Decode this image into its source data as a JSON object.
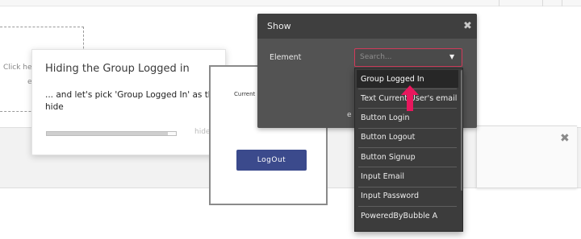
{
  "canvas": {
    "hint_line1": "Click he",
    "hint_line2": "e"
  },
  "tutorial": {
    "title": "Hiding the Group Logged in",
    "body": "... and let's pick 'Group Logged In' as the el to hide",
    "hide_label": "hide",
    "progress": 0.94
  },
  "preview": {
    "email_text": "Current User's email",
    "logout_label": "LogOut"
  },
  "show_panel": {
    "title": "Show",
    "element_label": "Element",
    "search_placeholder": "Search...",
    "hidden_text": "e"
  },
  "dropdown": {
    "items": [
      "Group Logged In",
      "Text Current User's email",
      "Button Login",
      "Button Logout",
      "Button Signup",
      "Input Email",
      "Input Password",
      "PoweredByBubble A"
    ],
    "active_index": 0
  },
  "colors": {
    "accent_pink": "#e8175d",
    "logout_button": "#3b4a8c",
    "select_border": "#d23a5a"
  },
  "icons": {
    "close": "close-icon",
    "caret": "caret-down-icon",
    "pointer": "pointer-arrow-icon"
  }
}
